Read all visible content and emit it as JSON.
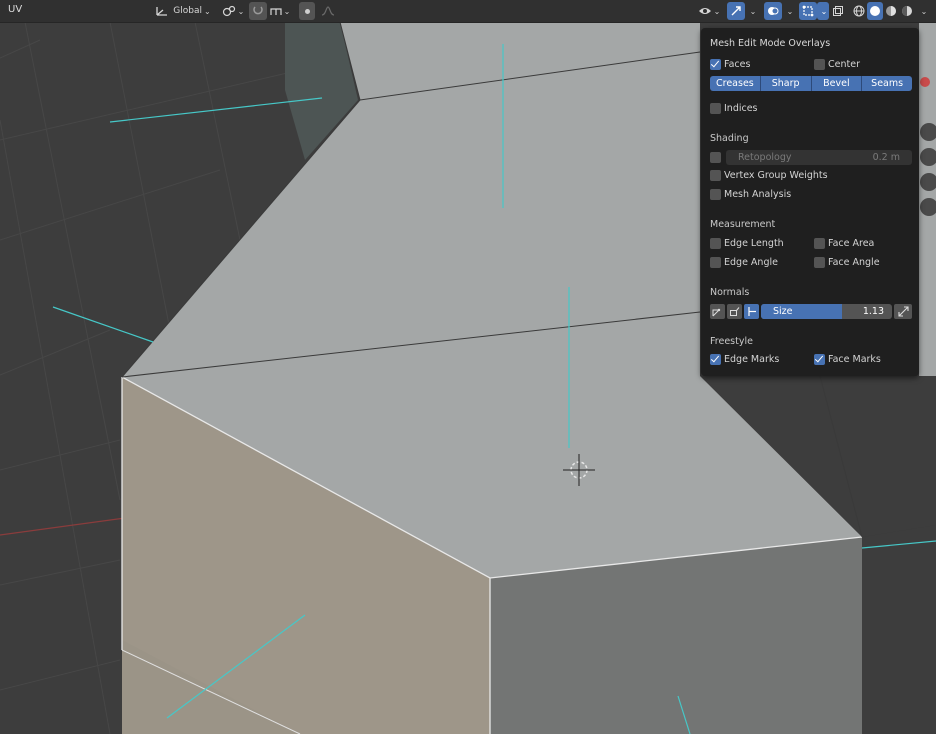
{
  "header": {
    "editor_label": "UV",
    "orientation_label": "Global"
  },
  "overlay": {
    "title": "Mesh Edit Mode Overlays",
    "faces_label": "Faces",
    "faces_checked": true,
    "center_label": "Center",
    "center_checked": false,
    "edge_buttons": [
      "Creases",
      "Sharp",
      "Bevel",
      "Seams"
    ],
    "indices_label": "Indices",
    "shading": {
      "title": "Shading",
      "retopology_label": "Retopology",
      "retopology_value": "0.2 m",
      "vertex_group_weights_label": "Vertex Group Weights",
      "mesh_analysis_label": "Mesh Analysis"
    },
    "measurement": {
      "title": "Measurement",
      "edge_length_label": "Edge Length",
      "face_area_label": "Face Area",
      "edge_angle_label": "Edge Angle",
      "face_angle_label": "Face Angle"
    },
    "normals": {
      "title": "Normals",
      "size_label": "Size",
      "size_value": "1.13",
      "size_fill_fraction": 0.62
    },
    "freestyle": {
      "title": "Freestyle",
      "edge_marks_label": "Edge Marks",
      "edge_marks_checked": true,
      "face_marks_label": "Face Marks",
      "face_marks_checked": true
    }
  },
  "colors": {
    "accent": "#4772b3",
    "panel_bg": "#1f1f1f",
    "normal_line": "#46c8c8",
    "top_face": "#a4a7a7",
    "front_face": "#9b9487",
    "side_face": "#737574"
  },
  "icons": [
    "gizmo-icon",
    "snap-icon",
    "proportional-icon",
    "overlay-icon",
    "xray-icon",
    "wireframe-shading-icon",
    "solid-shading-icon",
    "material-shading-icon",
    "rendered-shading-icon",
    "cursor-icon"
  ]
}
